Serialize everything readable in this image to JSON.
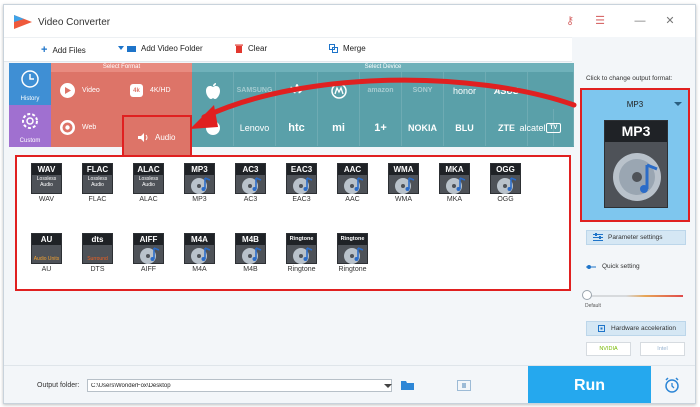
{
  "app": {
    "title": "Video Converter"
  },
  "toolbar": {
    "add_files": "Add Files",
    "add_video_folder": "Add Video Folder",
    "clear": "Clear",
    "merge": "Merge"
  },
  "categories": {
    "history": "History",
    "custom": "Custom",
    "select_format": "Select Format",
    "select_device": "Select Device",
    "formats": [
      "Video",
      "4K/HD",
      "Web",
      "Audio"
    ],
    "brands_row1": [
      "",
      "SAMSUNG",
      "",
      "",
      "amazon",
      "SONY",
      "honor",
      "ASUS"
    ],
    "brands_row2": [
      "",
      "Lenovo",
      "htc",
      "mi",
      "1+",
      "NOKIA",
      "BLU",
      "ZTE",
      "alcatel",
      "TV"
    ]
  },
  "formats": [
    {
      "tag": "WAV",
      "sub": "Lossless Audio",
      "label": "WAV"
    },
    {
      "tag": "FLAC",
      "sub": "Lossless Audio",
      "label": "FLAC"
    },
    {
      "tag": "ALAC",
      "sub": "Lossless Audio",
      "label": "ALAC"
    },
    {
      "tag": "MP3",
      "sub": "",
      "label": "MP3"
    },
    {
      "tag": "AC3",
      "sub": "",
      "label": "AC3"
    },
    {
      "tag": "EAC3",
      "sub": "",
      "label": "EAC3"
    },
    {
      "tag": "AAC",
      "sub": "",
      "label": "AAC"
    },
    {
      "tag": "WMA",
      "sub": "",
      "label": "WMA"
    },
    {
      "tag": "MKA",
      "sub": "",
      "label": "MKA"
    },
    {
      "tag": "OGG",
      "sub": "",
      "label": "OGG"
    },
    {
      "tag": "AU",
      "sub": "Audio Units",
      "label": "AU"
    },
    {
      "tag": "dts",
      "sub": "Surround",
      "label": "DTS"
    },
    {
      "tag": "AIFF",
      "sub": "",
      "label": "AIFF"
    },
    {
      "tag": "M4A",
      "sub": "",
      "label": "M4A"
    },
    {
      "tag": "M4B",
      "sub": "",
      "label": "M4B"
    },
    {
      "tag": "Ringtone",
      "sub": "",
      "label": "Ringtone"
    },
    {
      "tag": "Ringtone",
      "sub": "",
      "label": "Ringtone"
    }
  ],
  "output": {
    "click_label": "Click to change output format:",
    "format": "MP3",
    "param_settings": "Parameter settings",
    "quick_setting": "Quick setting",
    "default_label": "Default",
    "hw_accel": "Hardware acceleration",
    "nvidia": "NVIDIA",
    "intel": "Intel"
  },
  "bottom": {
    "folder_label": "Output folder:",
    "folder_path": "C:\\Users\\WonderFox\\Desktop",
    "run": "Run"
  }
}
